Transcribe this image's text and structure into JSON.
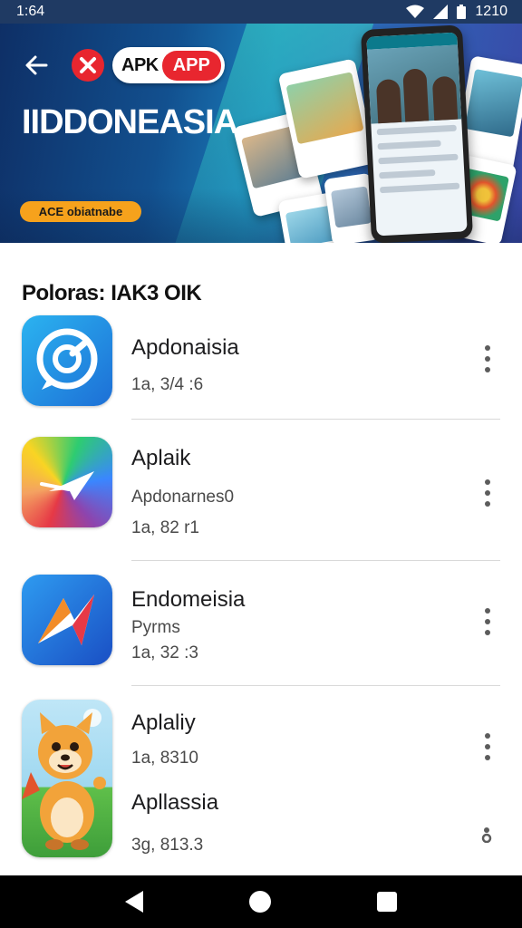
{
  "status_bar": {
    "time": "1:64",
    "clock_right": "1210",
    "icons": [
      "wifi-icon",
      "signal-icon",
      "battery-icon"
    ]
  },
  "hero": {
    "logo": {
      "apk": "APK",
      "app": "APP"
    },
    "title": "IIDDONEASIA",
    "badge": "ACE obiatnabe"
  },
  "section": {
    "title": "Poloras: IAK3 OIK"
  },
  "apps": [
    {
      "name": "Apdonaisia",
      "subtitle": "",
      "size": "1a, 3/4 :6",
      "icon": "chat-bubble-icon"
    },
    {
      "name": "Aplaik",
      "subtitle": "Apdonarnes0",
      "size": "1a, 82 r1",
      "icon": "paper-plane-icon"
    },
    {
      "name": "Endomeisia",
      "subtitle": "Pyrms",
      "size": "1a, 32 :3",
      "icon": "arrow-logo-icon"
    },
    {
      "name": "Aplaliy",
      "subtitle": "",
      "size": "1a, 8310",
      "icon": "fox-mascot-icon"
    },
    {
      "name": "Apllassia",
      "subtitle": "",
      "size": "3g, 813.3",
      "icon": ""
    }
  ],
  "colors": {
    "accent_red": "#e8262f",
    "badge_orange": "#f6a21c",
    "hero_blue": "#12508f"
  }
}
